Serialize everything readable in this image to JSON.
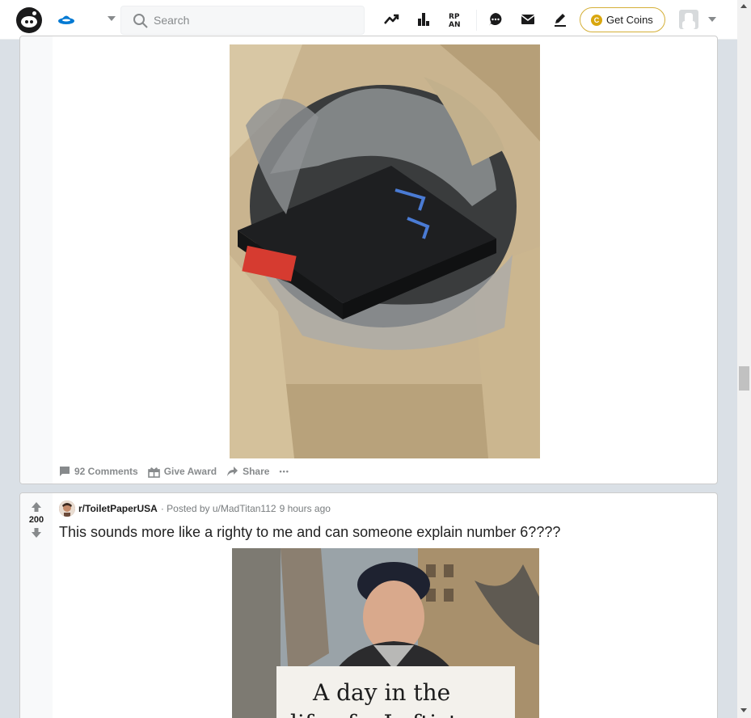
{
  "header": {
    "search_placeholder": "Search",
    "get_coins_label": "Get Coins",
    "coin_glyph": "C",
    "accent": "#0079d3",
    "coin_color": "#d9a70f"
  },
  "post1": {
    "image_alt": "PlayStation 2 console in a plastic bag",
    "actions": {
      "comments": "92 Comments",
      "award": "Give Award",
      "share": "Share",
      "more": "•••"
    }
  },
  "post2": {
    "votes": "200",
    "subreddit": "r/ToiletPaperUSA",
    "posted_by": "· Posted by u/MadTitan112",
    "time": "9 hours ago",
    "title": "This sounds more like a righty to me and can someone explain number 6????",
    "sign_line1": "A day in the",
    "sign_line2": "life of a Leftist"
  }
}
